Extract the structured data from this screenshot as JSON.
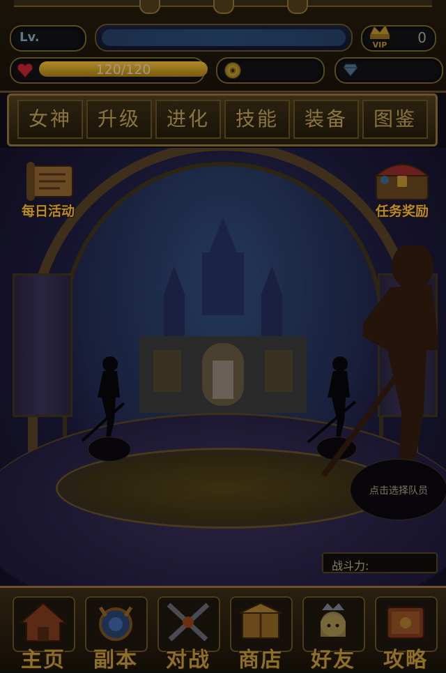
{
  "status": {
    "level_label": "Lv.",
    "vip_label": "VIP",
    "vip_value": "0",
    "hp_text": "120/120",
    "hp_fraction": 1.0,
    "gold_value": "",
    "gem_value": ""
  },
  "tabs": [
    {
      "label": "女神"
    },
    {
      "label": "升级"
    },
    {
      "label": "进化"
    },
    {
      "label": "技能"
    },
    {
      "label": "装备"
    },
    {
      "label": "图鉴"
    }
  ],
  "side": {
    "daily_label": "每日活动",
    "reward_label": "任务奖励"
  },
  "team": {
    "select_prompt": "点击选择队员",
    "power_label": "战斗力:"
  },
  "nav": [
    {
      "label": "主页",
      "icon": "home-icon"
    },
    {
      "label": "副本",
      "icon": "dungeon-icon"
    },
    {
      "label": "对战",
      "icon": "battle-icon"
    },
    {
      "label": "商店",
      "icon": "shop-icon"
    },
    {
      "label": "好友",
      "icon": "friends-icon"
    },
    {
      "label": "攻略",
      "icon": "guide-icon"
    }
  ],
  "colors": {
    "gold_text": "#8e6f2a",
    "hp_bar": "#b08a2a",
    "frame": "#6b5428"
  }
}
